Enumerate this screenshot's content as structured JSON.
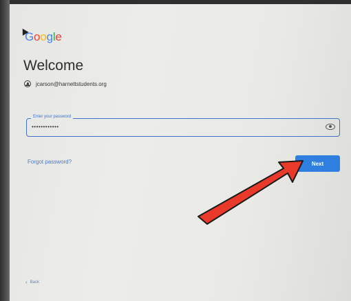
{
  "brand": {
    "letters": [
      "G",
      "o",
      "o",
      "g",
      "l",
      "e"
    ],
    "colors": [
      "#4285F4",
      "#EA4335",
      "#FBBC05",
      "#4285F4",
      "#34A853",
      "#EA4335"
    ]
  },
  "page": {
    "title": "Welcome",
    "account_email": "jcarson@harnettstudents.org"
  },
  "password_field": {
    "label": "Enter your password",
    "value": "••••••••••••"
  },
  "links": {
    "forgot": "Forgot password?",
    "back": "Back"
  },
  "buttons": {
    "next": "Next"
  },
  "icons": {
    "account": "account-circle-icon",
    "show_password": "eye-icon",
    "back": "chevron-left-icon",
    "annotation": "red-arrow"
  },
  "colors": {
    "primary": "#2f7fe0",
    "annotation_arrow": "#e8392a"
  }
}
